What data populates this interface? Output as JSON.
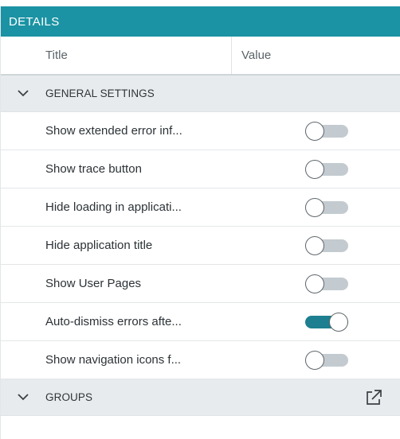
{
  "header": {
    "title": "DETAILS"
  },
  "columns": {
    "title": "Title",
    "value": "Value"
  },
  "groups": [
    {
      "label": "GENERAL SETTINGS",
      "expanded": true,
      "icon": "chevron-down-icon",
      "settings": [
        {
          "label": "Show extended error inf...",
          "enabled": false
        },
        {
          "label": "Show trace button",
          "enabled": false
        },
        {
          "label": "Hide loading in applicati...",
          "enabled": false
        },
        {
          "label": "Hide application title",
          "enabled": false
        },
        {
          "label": "Show User Pages",
          "enabled": false
        },
        {
          "label": "Auto-dismiss errors afte...",
          "enabled": true
        },
        {
          "label": "Show navigation icons f...",
          "enabled": false
        }
      ]
    },
    {
      "label": "GROUPS",
      "expanded": true,
      "icon": "chevron-down-icon",
      "action_icon": "external-link-icon"
    }
  ],
  "colors": {
    "header_bg": "#1b93a4",
    "toggle_on": "#1d7f90",
    "toggle_off": "#c3cbd0",
    "group_bg": "#e8ebed"
  }
}
